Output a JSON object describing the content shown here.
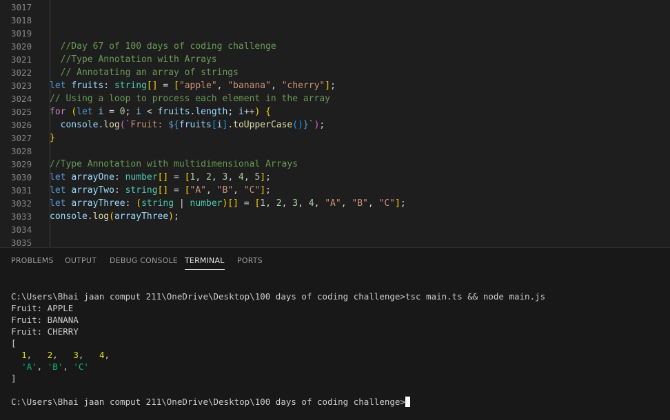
{
  "editor": {
    "lines": [
      {
        "n": "3017",
        "tokens": []
      },
      {
        "n": "3018",
        "tokens": []
      },
      {
        "n": "3019",
        "tokens": []
      },
      {
        "n": "3020",
        "tokens": [
          {
            "t": "  //Day 67 of 100 days of coding challenge",
            "c": "comment"
          }
        ]
      },
      {
        "n": "3021",
        "tokens": [
          {
            "t": "  //Type Annotation with Arrays",
            "c": "comment"
          }
        ]
      },
      {
        "n": "3022",
        "tokens": [
          {
            "t": "  // Annotating an array of strings",
            "c": "comment"
          }
        ]
      },
      {
        "n": "3023",
        "tokens": [
          {
            "t": "let ",
            "c": "keyword"
          },
          {
            "t": "fruits",
            "c": "var"
          },
          {
            "t": ": ",
            "c": "punct"
          },
          {
            "t": "string",
            "c": "type"
          },
          {
            "t": "[]",
            "c": "bracket1"
          },
          {
            "t": " = ",
            "c": "punct"
          },
          {
            "t": "[",
            "c": "bracket1"
          },
          {
            "t": "\"apple\"",
            "c": "string"
          },
          {
            "t": ", ",
            "c": "punct"
          },
          {
            "t": "\"banana\"",
            "c": "string"
          },
          {
            "t": ", ",
            "c": "punct"
          },
          {
            "t": "\"cherry\"",
            "c": "string"
          },
          {
            "t": "]",
            "c": "bracket1"
          },
          {
            "t": ";",
            "c": "punct"
          }
        ]
      },
      {
        "n": "3024",
        "tokens": [
          {
            "t": "// Using a loop to process each element in the array",
            "c": "comment"
          }
        ]
      },
      {
        "n": "3025",
        "tokens": [
          {
            "t": "for ",
            "c": "control"
          },
          {
            "t": "(",
            "c": "bracket1"
          },
          {
            "t": "let ",
            "c": "keyword"
          },
          {
            "t": "i",
            "c": "var"
          },
          {
            "t": " = ",
            "c": "punct"
          },
          {
            "t": "0",
            "c": "number"
          },
          {
            "t": "; ",
            "c": "punct"
          },
          {
            "t": "i",
            "c": "var"
          },
          {
            "t": " < ",
            "c": "punct"
          },
          {
            "t": "fruits",
            "c": "var"
          },
          {
            "t": ".",
            "c": "punct"
          },
          {
            "t": "length",
            "c": "var"
          },
          {
            "t": "; ",
            "c": "punct"
          },
          {
            "t": "i",
            "c": "var"
          },
          {
            "t": "++",
            "c": "punct"
          },
          {
            "t": ")",
            "c": "bracket1"
          },
          {
            "t": " ",
            "c": "punct"
          },
          {
            "t": "{",
            "c": "bracket1"
          }
        ]
      },
      {
        "n": "3026",
        "tokens": [
          {
            "t": "  console",
            "c": "var"
          },
          {
            "t": ".",
            "c": "punct"
          },
          {
            "t": "log",
            "c": "fn"
          },
          {
            "t": "(",
            "c": "bracket2"
          },
          {
            "t": "`Fruit: ",
            "c": "string"
          },
          {
            "t": "${",
            "c": "keyword"
          },
          {
            "t": "fruits",
            "c": "var"
          },
          {
            "t": "[",
            "c": "bracket3"
          },
          {
            "t": "i",
            "c": "var"
          },
          {
            "t": "]",
            "c": "bracket3"
          },
          {
            "t": ".",
            "c": "punct"
          },
          {
            "t": "toUpperCase",
            "c": "fn"
          },
          {
            "t": "()",
            "c": "bracket3"
          },
          {
            "t": "}",
            "c": "keyword"
          },
          {
            "t": "`",
            "c": "string"
          },
          {
            "t": ")",
            "c": "bracket2"
          },
          {
            "t": ";",
            "c": "punct"
          }
        ]
      },
      {
        "n": "3027",
        "tokens": [
          {
            "t": "}",
            "c": "bracket1"
          }
        ]
      },
      {
        "n": "3028",
        "tokens": []
      },
      {
        "n": "3029",
        "tokens": [
          {
            "t": "//Type Annotation with multidimensional Arrays",
            "c": "comment"
          }
        ]
      },
      {
        "n": "3030",
        "tokens": [
          {
            "t": "let ",
            "c": "keyword"
          },
          {
            "t": "arrayOne",
            "c": "var"
          },
          {
            "t": ": ",
            "c": "punct"
          },
          {
            "t": "number",
            "c": "type"
          },
          {
            "t": "[]",
            "c": "bracket1"
          },
          {
            "t": " = ",
            "c": "punct"
          },
          {
            "t": "[",
            "c": "bracket1"
          },
          {
            "t": "1",
            "c": "number"
          },
          {
            "t": ", ",
            "c": "punct"
          },
          {
            "t": "2",
            "c": "number"
          },
          {
            "t": ", ",
            "c": "punct"
          },
          {
            "t": "3",
            "c": "number"
          },
          {
            "t": ", ",
            "c": "punct"
          },
          {
            "t": "4",
            "c": "number"
          },
          {
            "t": ", ",
            "c": "punct"
          },
          {
            "t": "5",
            "c": "number"
          },
          {
            "t": "]",
            "c": "bracket1"
          },
          {
            "t": ";",
            "c": "punct"
          }
        ]
      },
      {
        "n": "3031",
        "tokens": [
          {
            "t": "let ",
            "c": "keyword"
          },
          {
            "t": "arrayTwo",
            "c": "var"
          },
          {
            "t": ": ",
            "c": "punct"
          },
          {
            "t": "string",
            "c": "type"
          },
          {
            "t": "[]",
            "c": "bracket1"
          },
          {
            "t": " = ",
            "c": "punct"
          },
          {
            "t": "[",
            "c": "bracket1"
          },
          {
            "t": "\"A\"",
            "c": "string"
          },
          {
            "t": ", ",
            "c": "punct"
          },
          {
            "t": "\"B\"",
            "c": "string"
          },
          {
            "t": ", ",
            "c": "punct"
          },
          {
            "t": "\"C\"",
            "c": "string"
          },
          {
            "t": "]",
            "c": "bracket1"
          },
          {
            "t": ";",
            "c": "punct"
          }
        ]
      },
      {
        "n": "3032",
        "tokens": [
          {
            "t": "let ",
            "c": "keyword"
          },
          {
            "t": "arrayThree",
            "c": "var"
          },
          {
            "t": ": ",
            "c": "punct"
          },
          {
            "t": "(",
            "c": "bracket1"
          },
          {
            "t": "string",
            "c": "type"
          },
          {
            "t": " | ",
            "c": "punct"
          },
          {
            "t": "number",
            "c": "type"
          },
          {
            "t": ")",
            "c": "bracket1"
          },
          {
            "t": "[]",
            "c": "bracket1"
          },
          {
            "t": " = ",
            "c": "punct"
          },
          {
            "t": "[",
            "c": "bracket1"
          },
          {
            "t": "1",
            "c": "number"
          },
          {
            "t": ", ",
            "c": "punct"
          },
          {
            "t": "2",
            "c": "number"
          },
          {
            "t": ", ",
            "c": "punct"
          },
          {
            "t": "3",
            "c": "number"
          },
          {
            "t": ", ",
            "c": "punct"
          },
          {
            "t": "4",
            "c": "number"
          },
          {
            "t": ", ",
            "c": "punct"
          },
          {
            "t": "\"A\"",
            "c": "string"
          },
          {
            "t": ", ",
            "c": "punct"
          },
          {
            "t": "\"B\"",
            "c": "string"
          },
          {
            "t": ", ",
            "c": "punct"
          },
          {
            "t": "\"C\"",
            "c": "string"
          },
          {
            "t": "]",
            "c": "bracket1"
          },
          {
            "t": ";",
            "c": "punct"
          }
        ]
      },
      {
        "n": "3033",
        "tokens": [
          {
            "t": "console",
            "c": "var"
          },
          {
            "t": ".",
            "c": "punct"
          },
          {
            "t": "log",
            "c": "fn"
          },
          {
            "t": "(",
            "c": "bracket1"
          },
          {
            "t": "arrayThree",
            "c": "var"
          },
          {
            "t": ")",
            "c": "bracket1"
          },
          {
            "t": ";",
            "c": "punct"
          }
        ]
      },
      {
        "n": "3034",
        "tokens": []
      },
      {
        "n": "3035",
        "tokens": []
      }
    ]
  },
  "panel": {
    "tabs": [
      {
        "id": "problems",
        "label": "PROBLEMS",
        "active": false
      },
      {
        "id": "output",
        "label": "OUTPUT",
        "active": false
      },
      {
        "id": "debug-console",
        "label": "DEBUG CONSOLE",
        "active": false
      },
      {
        "id": "terminal",
        "label": "TERMINAL",
        "active": true
      },
      {
        "id": "ports",
        "label": "PORTS",
        "active": false
      }
    ]
  },
  "terminal": {
    "lines": [
      [
        {
          "t": "C:\\Users\\Bhai jaan comput 211\\OneDrive\\Desktop\\100 days of coding challenge>tsc main.ts && node main.js",
          "c": "plain"
        }
      ],
      [
        {
          "t": "Fruit: APPLE",
          "c": "plain"
        }
      ],
      [
        {
          "t": "Fruit: BANANA",
          "c": "plain"
        }
      ],
      [
        {
          "t": "Fruit: CHERRY",
          "c": "plain"
        }
      ],
      [
        {
          "t": "[",
          "c": "plain"
        }
      ],
      [
        {
          "t": "  ",
          "c": "plain"
        },
        {
          "t": "1",
          "c": "yellow"
        },
        {
          "t": ",   ",
          "c": "plain"
        },
        {
          "t": "2",
          "c": "yellow"
        },
        {
          "t": ",   ",
          "c": "plain"
        },
        {
          "t": "3",
          "c": "yellow"
        },
        {
          "t": ",   ",
          "c": "plain"
        },
        {
          "t": "4",
          "c": "yellow"
        },
        {
          "t": ",",
          "c": "plain"
        }
      ],
      [
        {
          "t": "  ",
          "c": "plain"
        },
        {
          "t": "'A'",
          "c": "green"
        },
        {
          "t": ", ",
          "c": "plain"
        },
        {
          "t": "'B'",
          "c": "green"
        },
        {
          "t": ", ",
          "c": "plain"
        },
        {
          "t": "'C'",
          "c": "green"
        }
      ],
      [
        {
          "t": "]",
          "c": "plain"
        }
      ],
      [],
      [
        {
          "t": "C:\\Users\\Bhai jaan comput 211\\OneDrive\\Desktop\\100 days of coding challenge>",
          "c": "plain"
        }
      ]
    ],
    "prompt_line_index": 9
  },
  "colors": {
    "editor_bg": "#1e1e1e",
    "panel_bg": "#181818",
    "comment": "#6a9955",
    "keyword": "#569cd6",
    "variable": "#9cdcfe",
    "type": "#4ec9b0",
    "string": "#ce9178",
    "number": "#b5cea8"
  }
}
